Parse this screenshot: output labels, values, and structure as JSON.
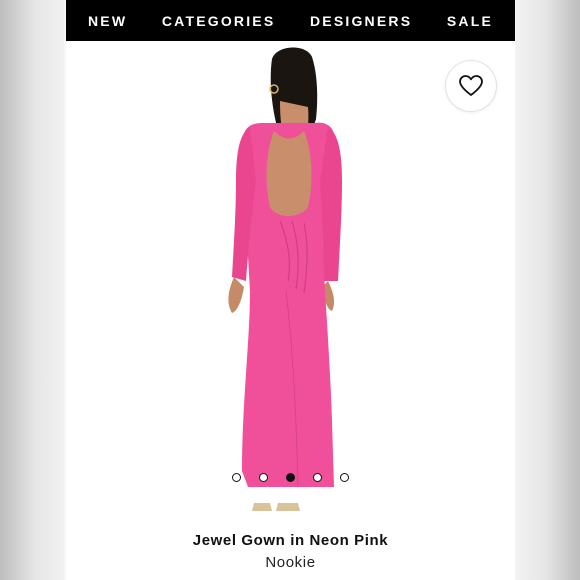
{
  "nav": {
    "items": [
      {
        "label": "NEW"
      },
      {
        "label": "CATEGORIES"
      },
      {
        "label": "DESIGNERS"
      },
      {
        "label": "SALE"
      }
    ]
  },
  "wishlist": {
    "icon": "heart-outline-icon"
  },
  "gallery": {
    "image_count": 5,
    "active_index": 2
  },
  "product": {
    "title": "Jewel Gown in Neon Pink",
    "brand": "Nookie",
    "dress_color": "#f0509a"
  }
}
